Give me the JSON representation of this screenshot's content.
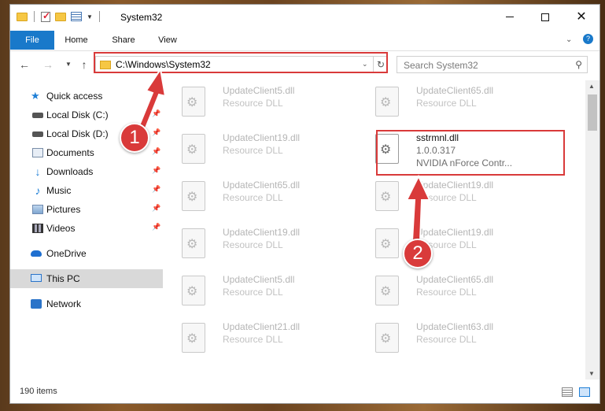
{
  "window": {
    "title": "System32",
    "controls": {
      "minimize": "minimize-icon",
      "maximize": "maximize-icon",
      "close": "close-icon"
    }
  },
  "ribbon": {
    "tabs": [
      {
        "label": "File"
      },
      {
        "label": "Home"
      },
      {
        "label": "Share"
      },
      {
        "label": "View"
      }
    ]
  },
  "navigation": {
    "address_path": "C:\\Windows\\System32",
    "search_placeholder": "Search System32"
  },
  "sidebar": {
    "items": [
      {
        "label": "Quick access",
        "icon": "star-icon"
      },
      {
        "label": "Local Disk (C:)",
        "icon": "disk-icon",
        "pinned": true
      },
      {
        "label": "Local Disk (D:)",
        "icon": "disk-icon",
        "pinned": true
      },
      {
        "label": "Documents",
        "icon": "documents-icon",
        "pinned": true
      },
      {
        "label": "Downloads",
        "icon": "downloads-icon",
        "pinned": true
      },
      {
        "label": "Music",
        "icon": "music-icon",
        "pinned": true
      },
      {
        "label": "Pictures",
        "icon": "pictures-icon",
        "pinned": true
      },
      {
        "label": "Videos",
        "icon": "videos-icon",
        "pinned": true
      },
      {
        "label": "OneDrive",
        "icon": "onedrive-icon"
      },
      {
        "label": "This PC",
        "icon": "pc-icon",
        "selected": true
      },
      {
        "label": "Network",
        "icon": "network-icon"
      }
    ]
  },
  "files": {
    "left_column": [
      {
        "name": "UpdateClient5.dll",
        "type": "Resource DLL"
      },
      {
        "name": "UpdateClient19.dll",
        "type": "Resource DLL"
      },
      {
        "name": "UpdateClient65.dll",
        "type": "Resource DLL"
      },
      {
        "name": "UpdateClient19.dll",
        "type": "Resource DLL"
      },
      {
        "name": "UpdateClient5.dll",
        "type": "Resource DLL"
      },
      {
        "name": "UpdateClient21.dll",
        "type": "Resource DLL"
      }
    ],
    "right_column": [
      {
        "name": "UpdateClient65.dll",
        "type": "Resource DLL"
      },
      {
        "name": "sstrmnl.dll",
        "version": "1.0.0.317",
        "type": "NVIDIA nForce Contr...",
        "highlighted": true
      },
      {
        "name": "UpdateClient19.dll",
        "type": "Resource DLL"
      },
      {
        "name": "UpdateClient19.dll",
        "type": "Resource DLL"
      },
      {
        "name": "UpdateClient65.dll",
        "type": "Resource DLL"
      },
      {
        "name": "UpdateClient63.dll",
        "type": "Resource DLL"
      }
    ]
  },
  "status": {
    "item_count": "190 items"
  },
  "annotations": {
    "step1": "1",
    "step2": "2",
    "color": "#d93a3a"
  }
}
